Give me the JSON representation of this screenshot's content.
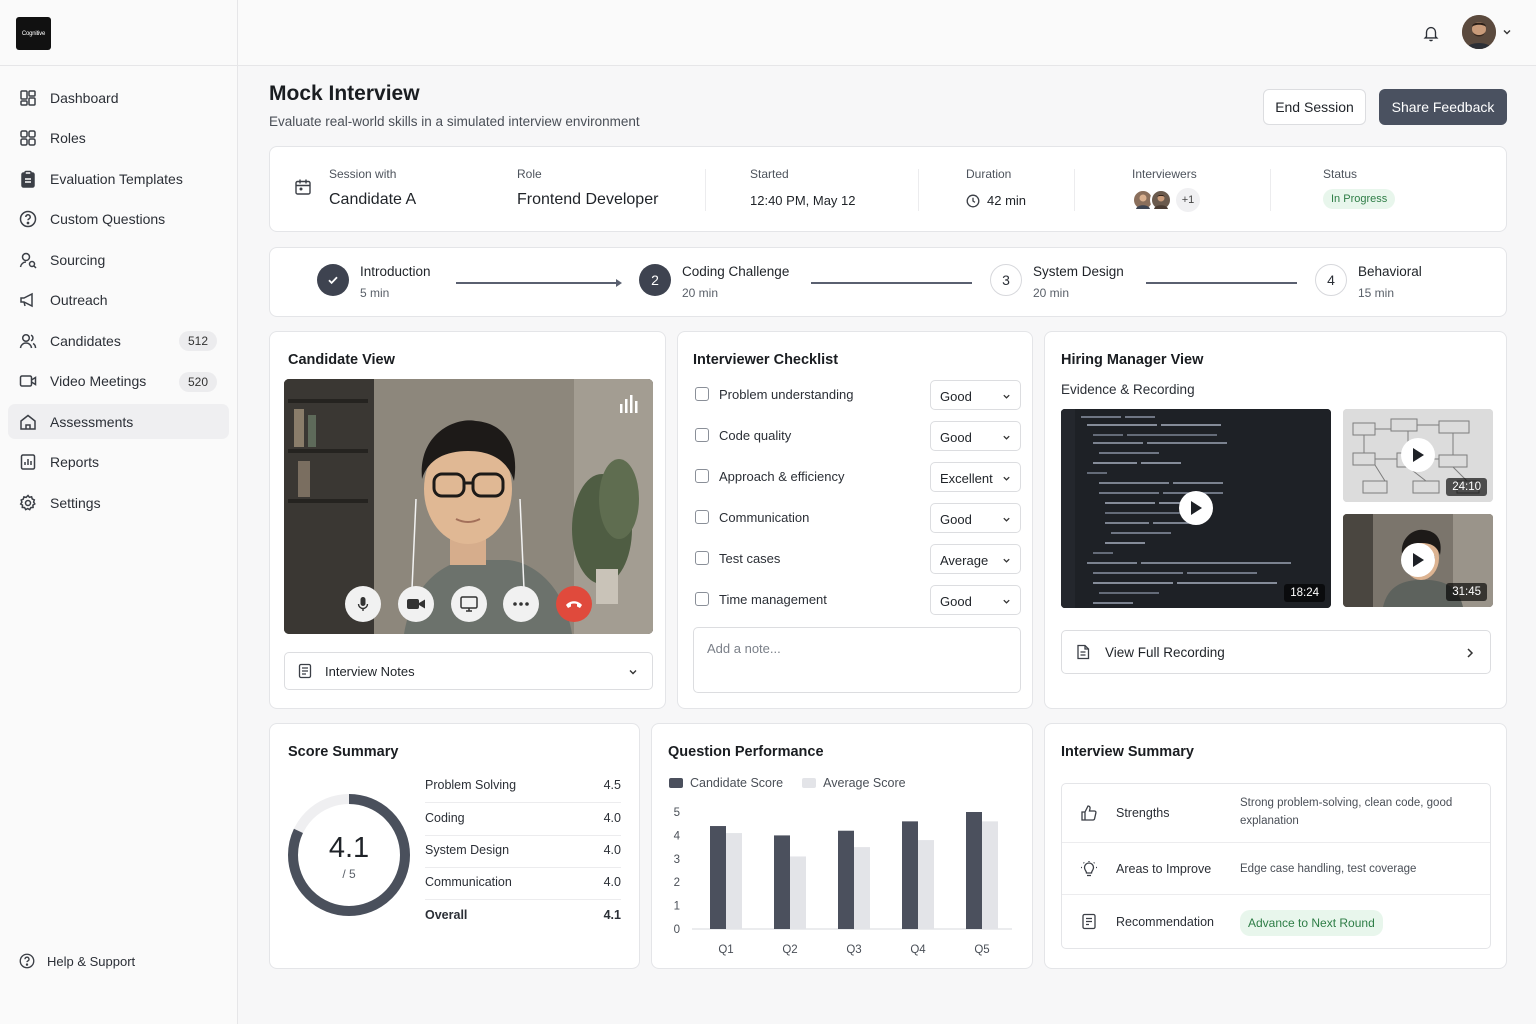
{
  "app": {
    "logo_text": "Cognitive"
  },
  "sidebar": {
    "items": [
      {
        "label": "Dashboard",
        "icon": "dashboard-icon"
      },
      {
        "label": "Roles",
        "icon": "grid-icon"
      },
      {
        "label": "Evaluation Templates",
        "icon": "clipboard-icon"
      },
      {
        "label": "Custom Questions",
        "icon": "help-circle-icon"
      },
      {
        "label": "Sourcing",
        "icon": "user-search-icon"
      },
      {
        "label": "Outreach",
        "icon": "megaphone-icon"
      },
      {
        "label": "Candidates",
        "icon": "users-icon",
        "badge": "512"
      },
      {
        "label": "Video Meetings",
        "icon": "video-icon",
        "badge": "520"
      },
      {
        "label": "Assessments",
        "icon": "home-icon",
        "active": true
      },
      {
        "label": "Reports",
        "icon": "report-icon"
      },
      {
        "label": "Settings",
        "icon": "gear-icon"
      }
    ],
    "help_label": "Help & Support"
  },
  "header": {
    "title": "Mock Interview",
    "subtitle": "Evaluate real-world skills in a simulated interview environment",
    "end_session": "End Session",
    "share_feedback": "Share Feedback"
  },
  "session": {
    "with_label": "Session with",
    "with_value": "Candidate A",
    "role_label": "Role",
    "role_value": "Frontend Developer",
    "started_label": "Started",
    "started_value": "12:40 PM, May 12",
    "duration_label": "Duration",
    "duration_value": "42 min",
    "interviewers_label": "Interviewers",
    "interviewers_more": "+1",
    "status_label": "Status",
    "status_value": "In Progress"
  },
  "steps": [
    {
      "num": "1",
      "title": "Introduction",
      "sub": "5 min",
      "state": "done"
    },
    {
      "num": "2",
      "title": "Coding Challenge",
      "sub": "20 min",
      "state": "current"
    },
    {
      "num": "3",
      "title": "System Design",
      "sub": "20 min",
      "state": "todo"
    },
    {
      "num": "4",
      "title": "Behavioral",
      "sub": "15 min",
      "state": "todo"
    }
  ],
  "candidate_view": {
    "title": "Candidate View",
    "notes_label": "Interview Notes"
  },
  "checklist": {
    "title": "Interviewer Checklist",
    "items": [
      {
        "label": "Problem understanding",
        "rating": "Good"
      },
      {
        "label": "Code quality",
        "rating": "Good"
      },
      {
        "label": "Approach & efficiency",
        "rating": "Excellent"
      },
      {
        "label": "Communication",
        "rating": "Good"
      },
      {
        "label": "Test cases",
        "rating": "Average"
      },
      {
        "label": "Time management",
        "rating": "Good"
      }
    ],
    "note_placeholder": "Add a note..."
  },
  "hiring_manager": {
    "title": "Hiring Manager View",
    "subtitle": "Evidence & Recording",
    "main_duration": "18:24",
    "thumb1_duration": "24:10",
    "thumb2_duration": "31:45",
    "view_full": "View Full Recording"
  },
  "score_summary": {
    "title": "Score Summary",
    "score": "4.1",
    "out_of": "/ 5",
    "score_fraction": 0.82,
    "rows": [
      {
        "name": "Problem Solving",
        "value": "4.5"
      },
      {
        "name": "Coding",
        "value": "4.0"
      },
      {
        "name": "System Design",
        "value": "4.0"
      },
      {
        "name": "Communication",
        "value": "4.0"
      },
      {
        "name": "Overall",
        "value": "4.1"
      }
    ]
  },
  "chart_data": {
    "type": "bar",
    "title": "Question Performance",
    "categories": [
      "Q1",
      "Q2",
      "Q3",
      "Q4",
      "Q5"
    ],
    "series": [
      {
        "name": "Candidate Score",
        "values": [
          4.4,
          4.0,
          4.2,
          4.6,
          5.0
        ],
        "color": "#4b505d"
      },
      {
        "name": "Average Score",
        "values": [
          4.1,
          3.1,
          3.5,
          3.8,
          4.6
        ],
        "color": "#e3e4e8"
      }
    ],
    "yticks": [
      "0",
      "1",
      "2",
      "3",
      "4",
      "5"
    ],
    "ylim": [
      0,
      5
    ],
    "legend": "top-left"
  },
  "interview_summary": {
    "title": "Interview Summary",
    "rows": [
      {
        "label": "Strengths",
        "value": "Strong problem-solving, clean code, good explanation"
      },
      {
        "label": "Areas to Improve",
        "value": "Edge case handling, test coverage"
      },
      {
        "label": "Recommendation",
        "value": "Advance to Next Round"
      }
    ]
  }
}
